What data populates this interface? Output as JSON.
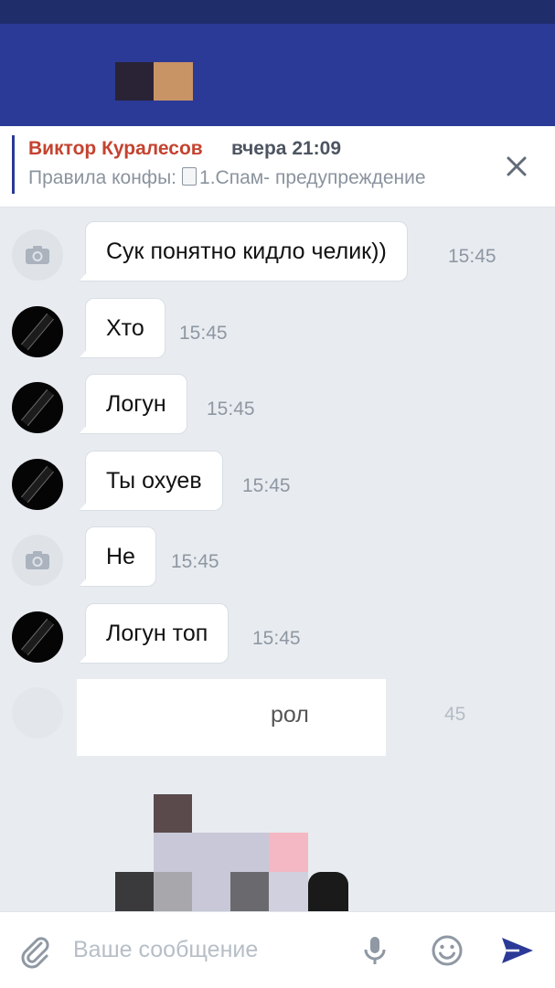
{
  "pinned": {
    "author": "Виктор Куралесов",
    "time": "вчера 21:09",
    "prefix": "Правила конфы:",
    "doc_text": "1.Спам- предупреждение"
  },
  "messages": [
    {
      "text": "Сук понятно кидло челик))",
      "time": "15:45",
      "avatar": "camera-icon"
    },
    {
      "text": "Хто",
      "time": "15:45",
      "avatar": "dark"
    },
    {
      "text": "Логун",
      "time": "15:45",
      "avatar": "dark"
    },
    {
      "text": "Ты охуев",
      "time": "15:45",
      "avatar": "dark"
    },
    {
      "text": "Не",
      "time": "15:45",
      "avatar": "camera-icon"
    },
    {
      "text": "Логун топ",
      "time": "15:45",
      "avatar": "dark"
    }
  ],
  "partial_message": {
    "text": "рол",
    "time": "45"
  },
  "composer": {
    "placeholder": "Ваше сообщение"
  },
  "colors": {
    "header": "#2b3a96",
    "accent": "#2b3a96",
    "author": "#c4432f",
    "background": "#e8ecf0"
  }
}
